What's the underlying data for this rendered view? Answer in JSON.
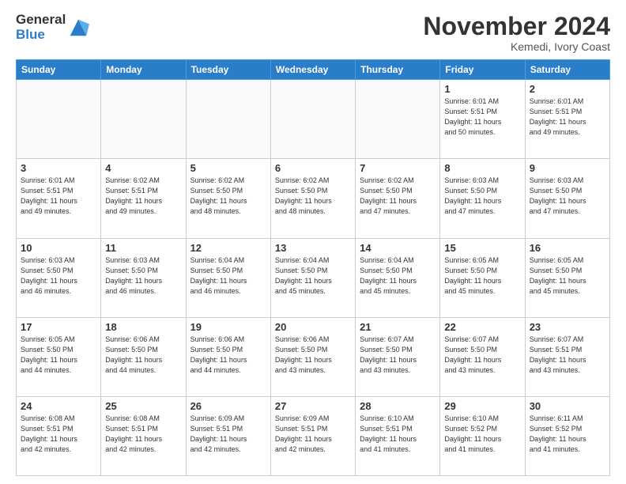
{
  "logo": {
    "general": "General",
    "blue": "Blue"
  },
  "title": "November 2024",
  "location": "Kemedi, Ivory Coast",
  "days_of_week": [
    "Sunday",
    "Monday",
    "Tuesday",
    "Wednesday",
    "Thursday",
    "Friday",
    "Saturday"
  ],
  "weeks": [
    [
      {
        "day": "",
        "info": ""
      },
      {
        "day": "",
        "info": ""
      },
      {
        "day": "",
        "info": ""
      },
      {
        "day": "",
        "info": ""
      },
      {
        "day": "",
        "info": ""
      },
      {
        "day": "1",
        "info": "Sunrise: 6:01 AM\nSunset: 5:51 PM\nDaylight: 11 hours\nand 50 minutes."
      },
      {
        "day": "2",
        "info": "Sunrise: 6:01 AM\nSunset: 5:51 PM\nDaylight: 11 hours\nand 49 minutes."
      }
    ],
    [
      {
        "day": "3",
        "info": "Sunrise: 6:01 AM\nSunset: 5:51 PM\nDaylight: 11 hours\nand 49 minutes."
      },
      {
        "day": "4",
        "info": "Sunrise: 6:02 AM\nSunset: 5:51 PM\nDaylight: 11 hours\nand 49 minutes."
      },
      {
        "day": "5",
        "info": "Sunrise: 6:02 AM\nSunset: 5:50 PM\nDaylight: 11 hours\nand 48 minutes."
      },
      {
        "day": "6",
        "info": "Sunrise: 6:02 AM\nSunset: 5:50 PM\nDaylight: 11 hours\nand 48 minutes."
      },
      {
        "day": "7",
        "info": "Sunrise: 6:02 AM\nSunset: 5:50 PM\nDaylight: 11 hours\nand 47 minutes."
      },
      {
        "day": "8",
        "info": "Sunrise: 6:03 AM\nSunset: 5:50 PM\nDaylight: 11 hours\nand 47 minutes."
      },
      {
        "day": "9",
        "info": "Sunrise: 6:03 AM\nSunset: 5:50 PM\nDaylight: 11 hours\nand 47 minutes."
      }
    ],
    [
      {
        "day": "10",
        "info": "Sunrise: 6:03 AM\nSunset: 5:50 PM\nDaylight: 11 hours\nand 46 minutes."
      },
      {
        "day": "11",
        "info": "Sunrise: 6:03 AM\nSunset: 5:50 PM\nDaylight: 11 hours\nand 46 minutes."
      },
      {
        "day": "12",
        "info": "Sunrise: 6:04 AM\nSunset: 5:50 PM\nDaylight: 11 hours\nand 46 minutes."
      },
      {
        "day": "13",
        "info": "Sunrise: 6:04 AM\nSunset: 5:50 PM\nDaylight: 11 hours\nand 45 minutes."
      },
      {
        "day": "14",
        "info": "Sunrise: 6:04 AM\nSunset: 5:50 PM\nDaylight: 11 hours\nand 45 minutes."
      },
      {
        "day": "15",
        "info": "Sunrise: 6:05 AM\nSunset: 5:50 PM\nDaylight: 11 hours\nand 45 minutes."
      },
      {
        "day": "16",
        "info": "Sunrise: 6:05 AM\nSunset: 5:50 PM\nDaylight: 11 hours\nand 45 minutes."
      }
    ],
    [
      {
        "day": "17",
        "info": "Sunrise: 6:05 AM\nSunset: 5:50 PM\nDaylight: 11 hours\nand 44 minutes."
      },
      {
        "day": "18",
        "info": "Sunrise: 6:06 AM\nSunset: 5:50 PM\nDaylight: 11 hours\nand 44 minutes."
      },
      {
        "day": "19",
        "info": "Sunrise: 6:06 AM\nSunset: 5:50 PM\nDaylight: 11 hours\nand 44 minutes."
      },
      {
        "day": "20",
        "info": "Sunrise: 6:06 AM\nSunset: 5:50 PM\nDaylight: 11 hours\nand 43 minutes."
      },
      {
        "day": "21",
        "info": "Sunrise: 6:07 AM\nSunset: 5:50 PM\nDaylight: 11 hours\nand 43 minutes."
      },
      {
        "day": "22",
        "info": "Sunrise: 6:07 AM\nSunset: 5:50 PM\nDaylight: 11 hours\nand 43 minutes."
      },
      {
        "day": "23",
        "info": "Sunrise: 6:07 AM\nSunset: 5:51 PM\nDaylight: 11 hours\nand 43 minutes."
      }
    ],
    [
      {
        "day": "24",
        "info": "Sunrise: 6:08 AM\nSunset: 5:51 PM\nDaylight: 11 hours\nand 42 minutes."
      },
      {
        "day": "25",
        "info": "Sunrise: 6:08 AM\nSunset: 5:51 PM\nDaylight: 11 hours\nand 42 minutes."
      },
      {
        "day": "26",
        "info": "Sunrise: 6:09 AM\nSunset: 5:51 PM\nDaylight: 11 hours\nand 42 minutes."
      },
      {
        "day": "27",
        "info": "Sunrise: 6:09 AM\nSunset: 5:51 PM\nDaylight: 11 hours\nand 42 minutes."
      },
      {
        "day": "28",
        "info": "Sunrise: 6:10 AM\nSunset: 5:51 PM\nDaylight: 11 hours\nand 41 minutes."
      },
      {
        "day": "29",
        "info": "Sunrise: 6:10 AM\nSunset: 5:52 PM\nDaylight: 11 hours\nand 41 minutes."
      },
      {
        "day": "30",
        "info": "Sunrise: 6:11 AM\nSunset: 5:52 PM\nDaylight: 11 hours\nand 41 minutes."
      }
    ]
  ]
}
